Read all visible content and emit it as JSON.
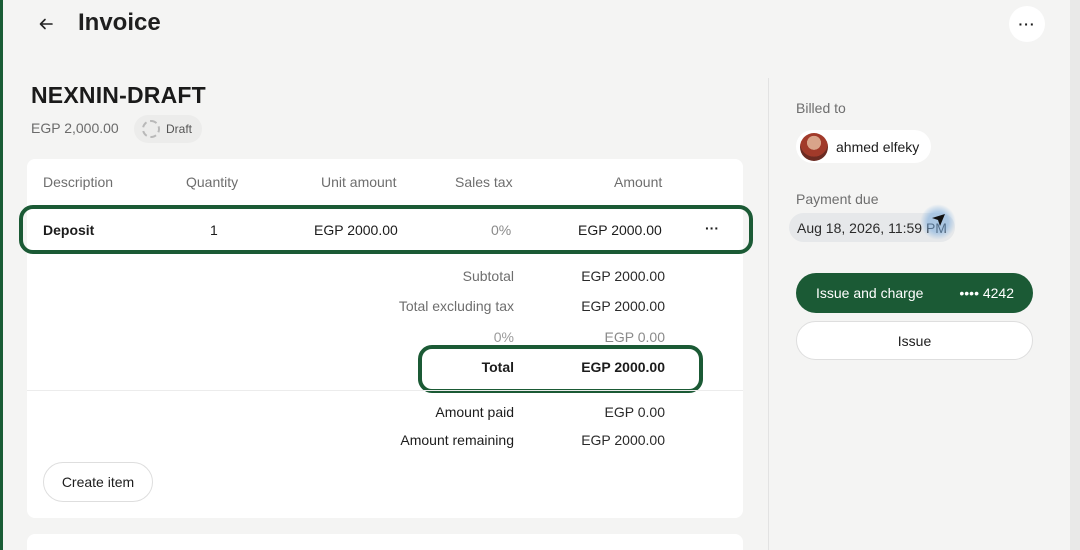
{
  "header": {
    "title": "Invoice",
    "more_label": "···"
  },
  "invoice": {
    "id": "NEXNIN-DRAFT",
    "amount": "EGP 2,000.00",
    "status": "Draft"
  },
  "table": {
    "columns": [
      "Description",
      "Quantity",
      "Unit amount",
      "Sales tax",
      "Amount"
    ],
    "rows": [
      {
        "description": "Deposit",
        "quantity": "1",
        "unit_amount": "EGP 2000.00",
        "sales_tax": "0%",
        "amount": "EGP 2000.00",
        "more": "···"
      }
    ]
  },
  "summary": {
    "subtotal_label": "Subtotal",
    "subtotal": "EGP 2000.00",
    "excl_tax_label": "Total excluding tax",
    "excl_tax": "EGP 2000.00",
    "tax_label": "0%",
    "tax": "EGP 0.00",
    "total_label": "Total",
    "total": "EGP 2000.00",
    "paid_label": "Amount paid",
    "paid": "EGP 0.00",
    "remaining_label": "Amount remaining",
    "remaining": "EGP 2000.00"
  },
  "actions": {
    "create_item": "Create item",
    "issue_and_charge": "Issue and charge",
    "card_last4": "•••• 4242",
    "issue": "Issue"
  },
  "sidebar": {
    "billed_to_label": "Billed to",
    "customer_name": "ahmed elfeky",
    "payment_due_label": "Payment due",
    "payment_due": "Aug 18, 2026, 11:59 PM"
  },
  "colors": {
    "accent": "#1b5a35",
    "background": "#f4f4f3",
    "card": "#ffffff"
  }
}
